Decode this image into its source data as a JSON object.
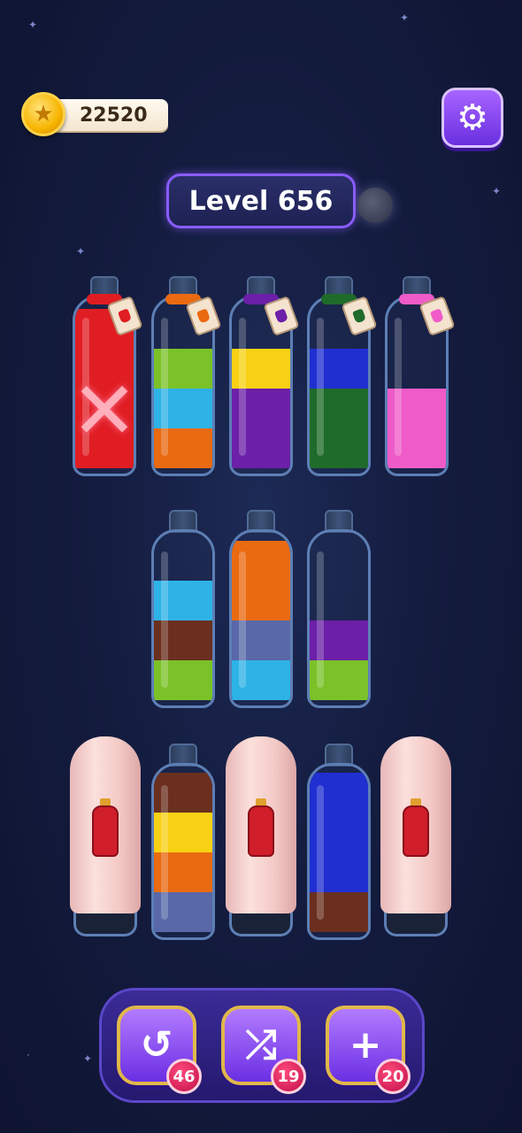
{
  "coins": {
    "value": "22520",
    "icon": "star-coin-icon"
  },
  "settings": {
    "icon": "gear-icon"
  },
  "level": {
    "label": "Level 656"
  },
  "colors": {
    "red": "#e01d22",
    "green": "#7bc229",
    "cyan": "#2db3e6",
    "orange": "#ea6a11",
    "yellow": "#f8d114",
    "purple": "#6c1fa8",
    "blue": "#1f2fd0",
    "darkgreen": "#1f6b2a",
    "pink": "#ef5bc8",
    "brown": "#6a2f1e",
    "slate": "#5868a8"
  },
  "bottles": [
    {
      "id": "b1",
      "layers": [
        "red",
        "red",
        "red",
        "red"
      ],
      "locked": true,
      "tag_color": "red"
    },
    {
      "id": "b2",
      "layers": [
        "orange",
        "cyan",
        "green"
      ],
      "tag_color": "orange"
    },
    {
      "id": "b3",
      "layers": [
        "purple",
        "purple",
        "yellow"
      ],
      "tag_color": "purple"
    },
    {
      "id": "b4",
      "layers": [
        "darkgreen",
        "darkgreen",
        "blue"
      ],
      "tag_color": "darkgreen"
    },
    {
      "id": "b5",
      "layers": [
        "pink",
        "pink"
      ],
      "tag_color": "pink"
    },
    {
      "id": "b6",
      "layers": [
        "green",
        "brown",
        "cyan"
      ]
    },
    {
      "id": "b7",
      "layers": [
        "cyan",
        "slate",
        "orange",
        "orange"
      ]
    },
    {
      "id": "b8",
      "layers": [
        "green",
        "purple"
      ]
    },
    {
      "id": "b9",
      "layers": [
        "slate",
        "orange",
        "yellow",
        "brown"
      ]
    },
    {
      "id": "b10",
      "layers": [
        "brown",
        "blue",
        "blue",
        "blue"
      ]
    }
  ],
  "covered_bottles": [
    {
      "id": "c1",
      "hint_color": "red"
    },
    {
      "id": "c2",
      "hint_color": "red"
    },
    {
      "id": "c3",
      "hint_color": "red"
    }
  ],
  "tools": [
    {
      "name": "undo",
      "icon": "undo-icon",
      "glyph": "↺",
      "count": "46"
    },
    {
      "name": "shuffle",
      "icon": "shuffle-icon",
      "glyph": "⤮",
      "count": "19"
    },
    {
      "name": "add-bottle",
      "icon": "add-bottle-icon",
      "glyph": "+",
      "count": "20"
    }
  ]
}
